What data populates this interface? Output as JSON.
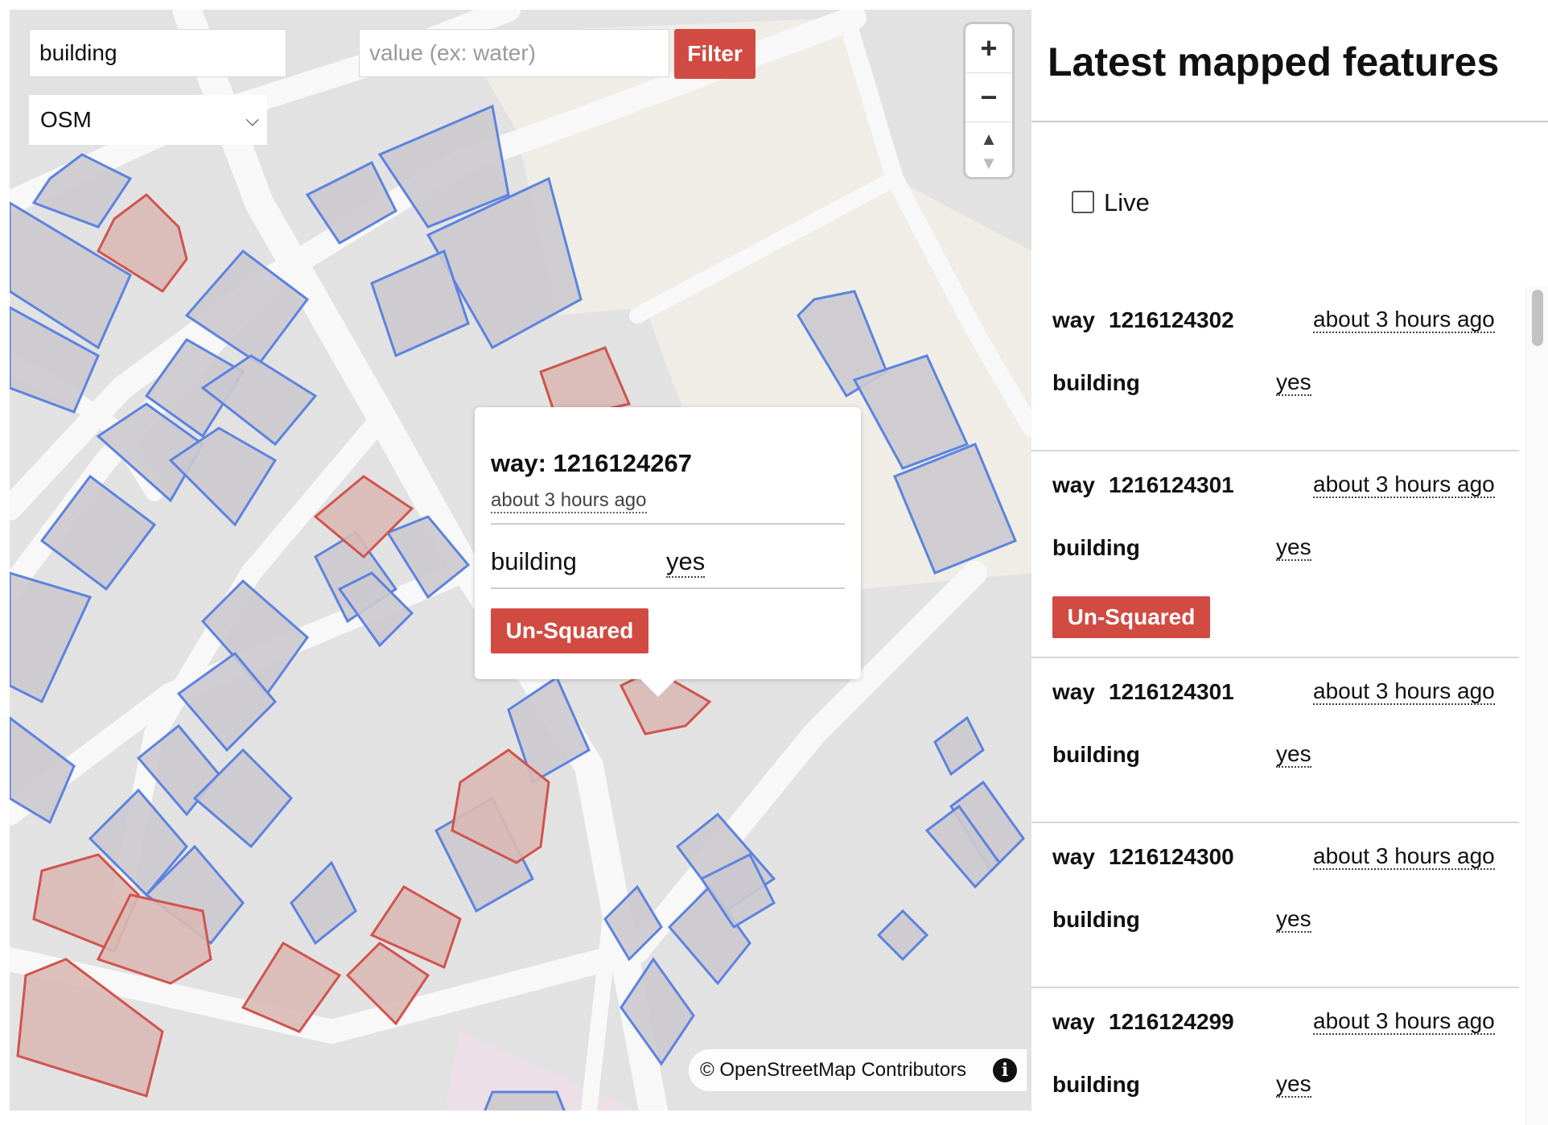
{
  "filters": {
    "key_value": "building",
    "value_placeholder": "value (ex: water)",
    "filter_label": "Filter",
    "source_selected": "OSM"
  },
  "zoom": {
    "in": "+",
    "out": "−",
    "reset": "▲"
  },
  "popup": {
    "title": "way: 1216124267",
    "time": "about 3 hours ago",
    "tag_key": "building",
    "tag_value": "yes",
    "badge": "Un-Squared"
  },
  "attribution": {
    "text": "© OpenStreetMap Contributors",
    "info": "i"
  },
  "sidebar": {
    "title": "Latest mapped features",
    "live_label": "Live",
    "items": [
      {
        "type": "way",
        "id": "1216124302",
        "time": "about 3 hours ago",
        "tag_key": "building",
        "tag_value": "yes",
        "badge": ""
      },
      {
        "type": "way",
        "id": "1216124301",
        "time": "about 3 hours ago",
        "tag_key": "building",
        "tag_value": "yes",
        "badge": "Un-Squared"
      },
      {
        "type": "way",
        "id": "1216124301",
        "time": "about 3 hours ago",
        "tag_key": "building",
        "tag_value": "yes",
        "badge": ""
      },
      {
        "type": "way",
        "id": "1216124300",
        "time": "about 3 hours ago",
        "tag_key": "building",
        "tag_value": "yes",
        "badge": ""
      },
      {
        "type": "way",
        "id": "1216124299",
        "time": "about 3 hours ago",
        "tag_key": "building",
        "tag_value": "yes",
        "badge": ""
      }
    ]
  },
  "colors": {
    "accent": "#d14b43",
    "building_ok_stroke": "#5b83e0",
    "building_flag_stroke": "#d0544c",
    "road": "#f8f8f8",
    "landuse": "#efede6"
  }
}
